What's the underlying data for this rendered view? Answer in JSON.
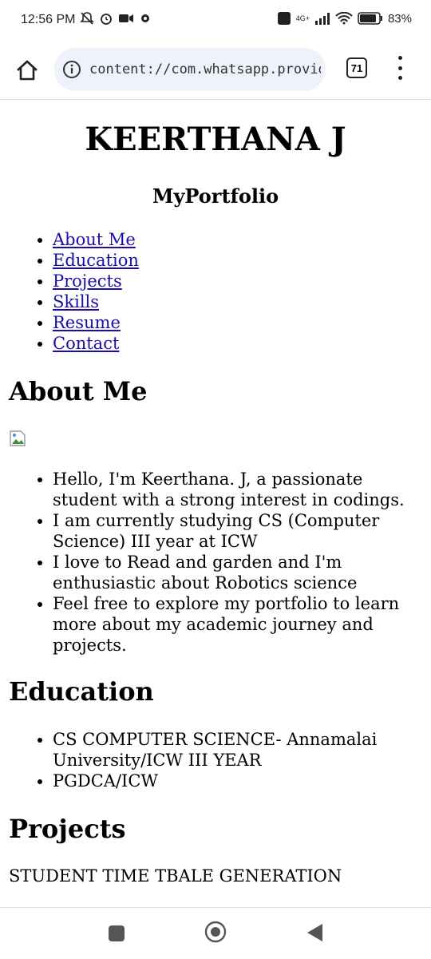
{
  "status_bar": {
    "time": "12:56 PM",
    "network": "4G+",
    "battery": "83%"
  },
  "browser": {
    "url": "content://com.whatsapp.provider.",
    "tab_count": "71"
  },
  "page": {
    "title": "KEERTHANA J",
    "subtitle": "MyPortfolio",
    "nav": [
      "About Me",
      "Education",
      "Projects",
      "Skills",
      "Resume",
      "Contact"
    ],
    "about": {
      "heading": "About Me",
      "items": [
        "Hello, I'm Keerthana. J, a passionate student with a strong interest in codings.",
        "I am currently studying CS (Computer Science) III year at ICW",
        "I love to Read and garden and I'm enthusiastic about Robotics science",
        "Feel free to explore my portfolio to learn more about my academic journey and projects."
      ]
    },
    "education": {
      "heading": "Education",
      "items": [
        "CS COMPUTER SCIENCE- Annamalai University/ICW III YEAR",
        "PGDCA/ICW"
      ]
    },
    "projects": {
      "heading": "Projects",
      "text": "STUDENT TIME TBALE GENERATION"
    }
  }
}
